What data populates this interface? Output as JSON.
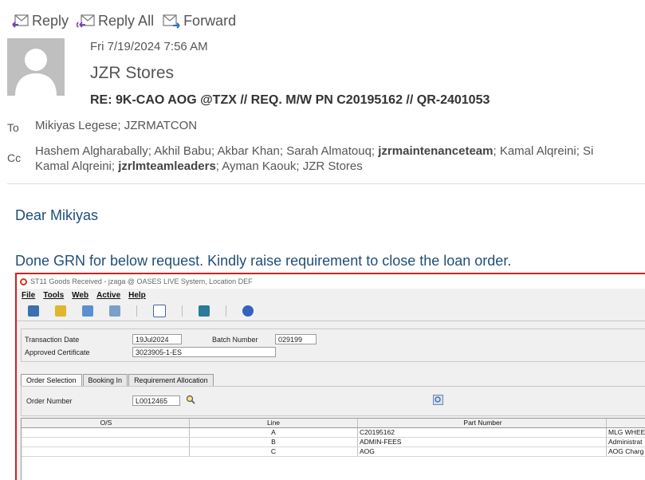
{
  "toolbar": {
    "reply_label": "Reply",
    "reply_all_label": "Reply All",
    "forward_label": "Forward"
  },
  "message": {
    "date": "Fri 7/19/2024 7:56 AM",
    "from": "JZR Stores",
    "subject": "RE: 9K-CAO AOG @TZX // REQ. M/W PN C20195162  //  QR-2401053",
    "to_label": "To",
    "to": "Mikiyas Legese; JZRMATCON",
    "cc_label": "Cc",
    "cc": [
      {
        "text": "Hashem Algharabally; Akhil Babu; Akbar Khan; Sarah Almatouq; ",
        "bold": false
      },
      {
        "text": "jzrmaintenanceteam",
        "bold": true
      },
      {
        "text": "; Kamal Alqreini; Si",
        "bold": false
      }
    ],
    "cc_line2": [
      {
        "text": "Kamal Alqreini; ",
        "bold": false
      },
      {
        "text": "jzrlmteamleaders",
        "bold": true
      },
      {
        "text": "; Ayman Kaouk; JZR Stores",
        "bold": false
      }
    ]
  },
  "body": {
    "greeting": "Dear Mikiyas",
    "text": "Done GRN for below request. Kindly raise requirement to close the loan order."
  },
  "screenshot": {
    "window_title": "ST11 Goods Received - jzaga @ OASES LIVE System, Location DEF",
    "menu": [
      "File",
      "Tools",
      "Web",
      "Active",
      "Help"
    ],
    "transaction_date_label": "Transaction Date",
    "transaction_date": "19Jul2024",
    "batch_number_label": "Batch Number",
    "batch_number": "029199",
    "approved_certificate_label": "Approved Certificate",
    "approved_certificate": "3023905-1-ES",
    "tabs": [
      "Order Selection",
      "Booking In",
      "Requirement Allocation"
    ],
    "order_number_label": "Order Number",
    "order_number": "L0012465",
    "grid": {
      "headers": [
        "O/S",
        "Line",
        "Part Number",
        ""
      ],
      "rows": [
        {
          "os": "",
          "line": "A",
          "part": "C20195162",
          "desc": "MLG WHEE"
        },
        {
          "os": "",
          "line": "B",
          "part": "ADMIN-FEES",
          "desc": "Administrat"
        },
        {
          "os": "",
          "line": "C",
          "part": "AOG",
          "desc": "AOG Charg"
        }
      ]
    }
  },
  "colors": {
    "body_text": "#1f4e79",
    "screenshot_border": "#d02020"
  }
}
